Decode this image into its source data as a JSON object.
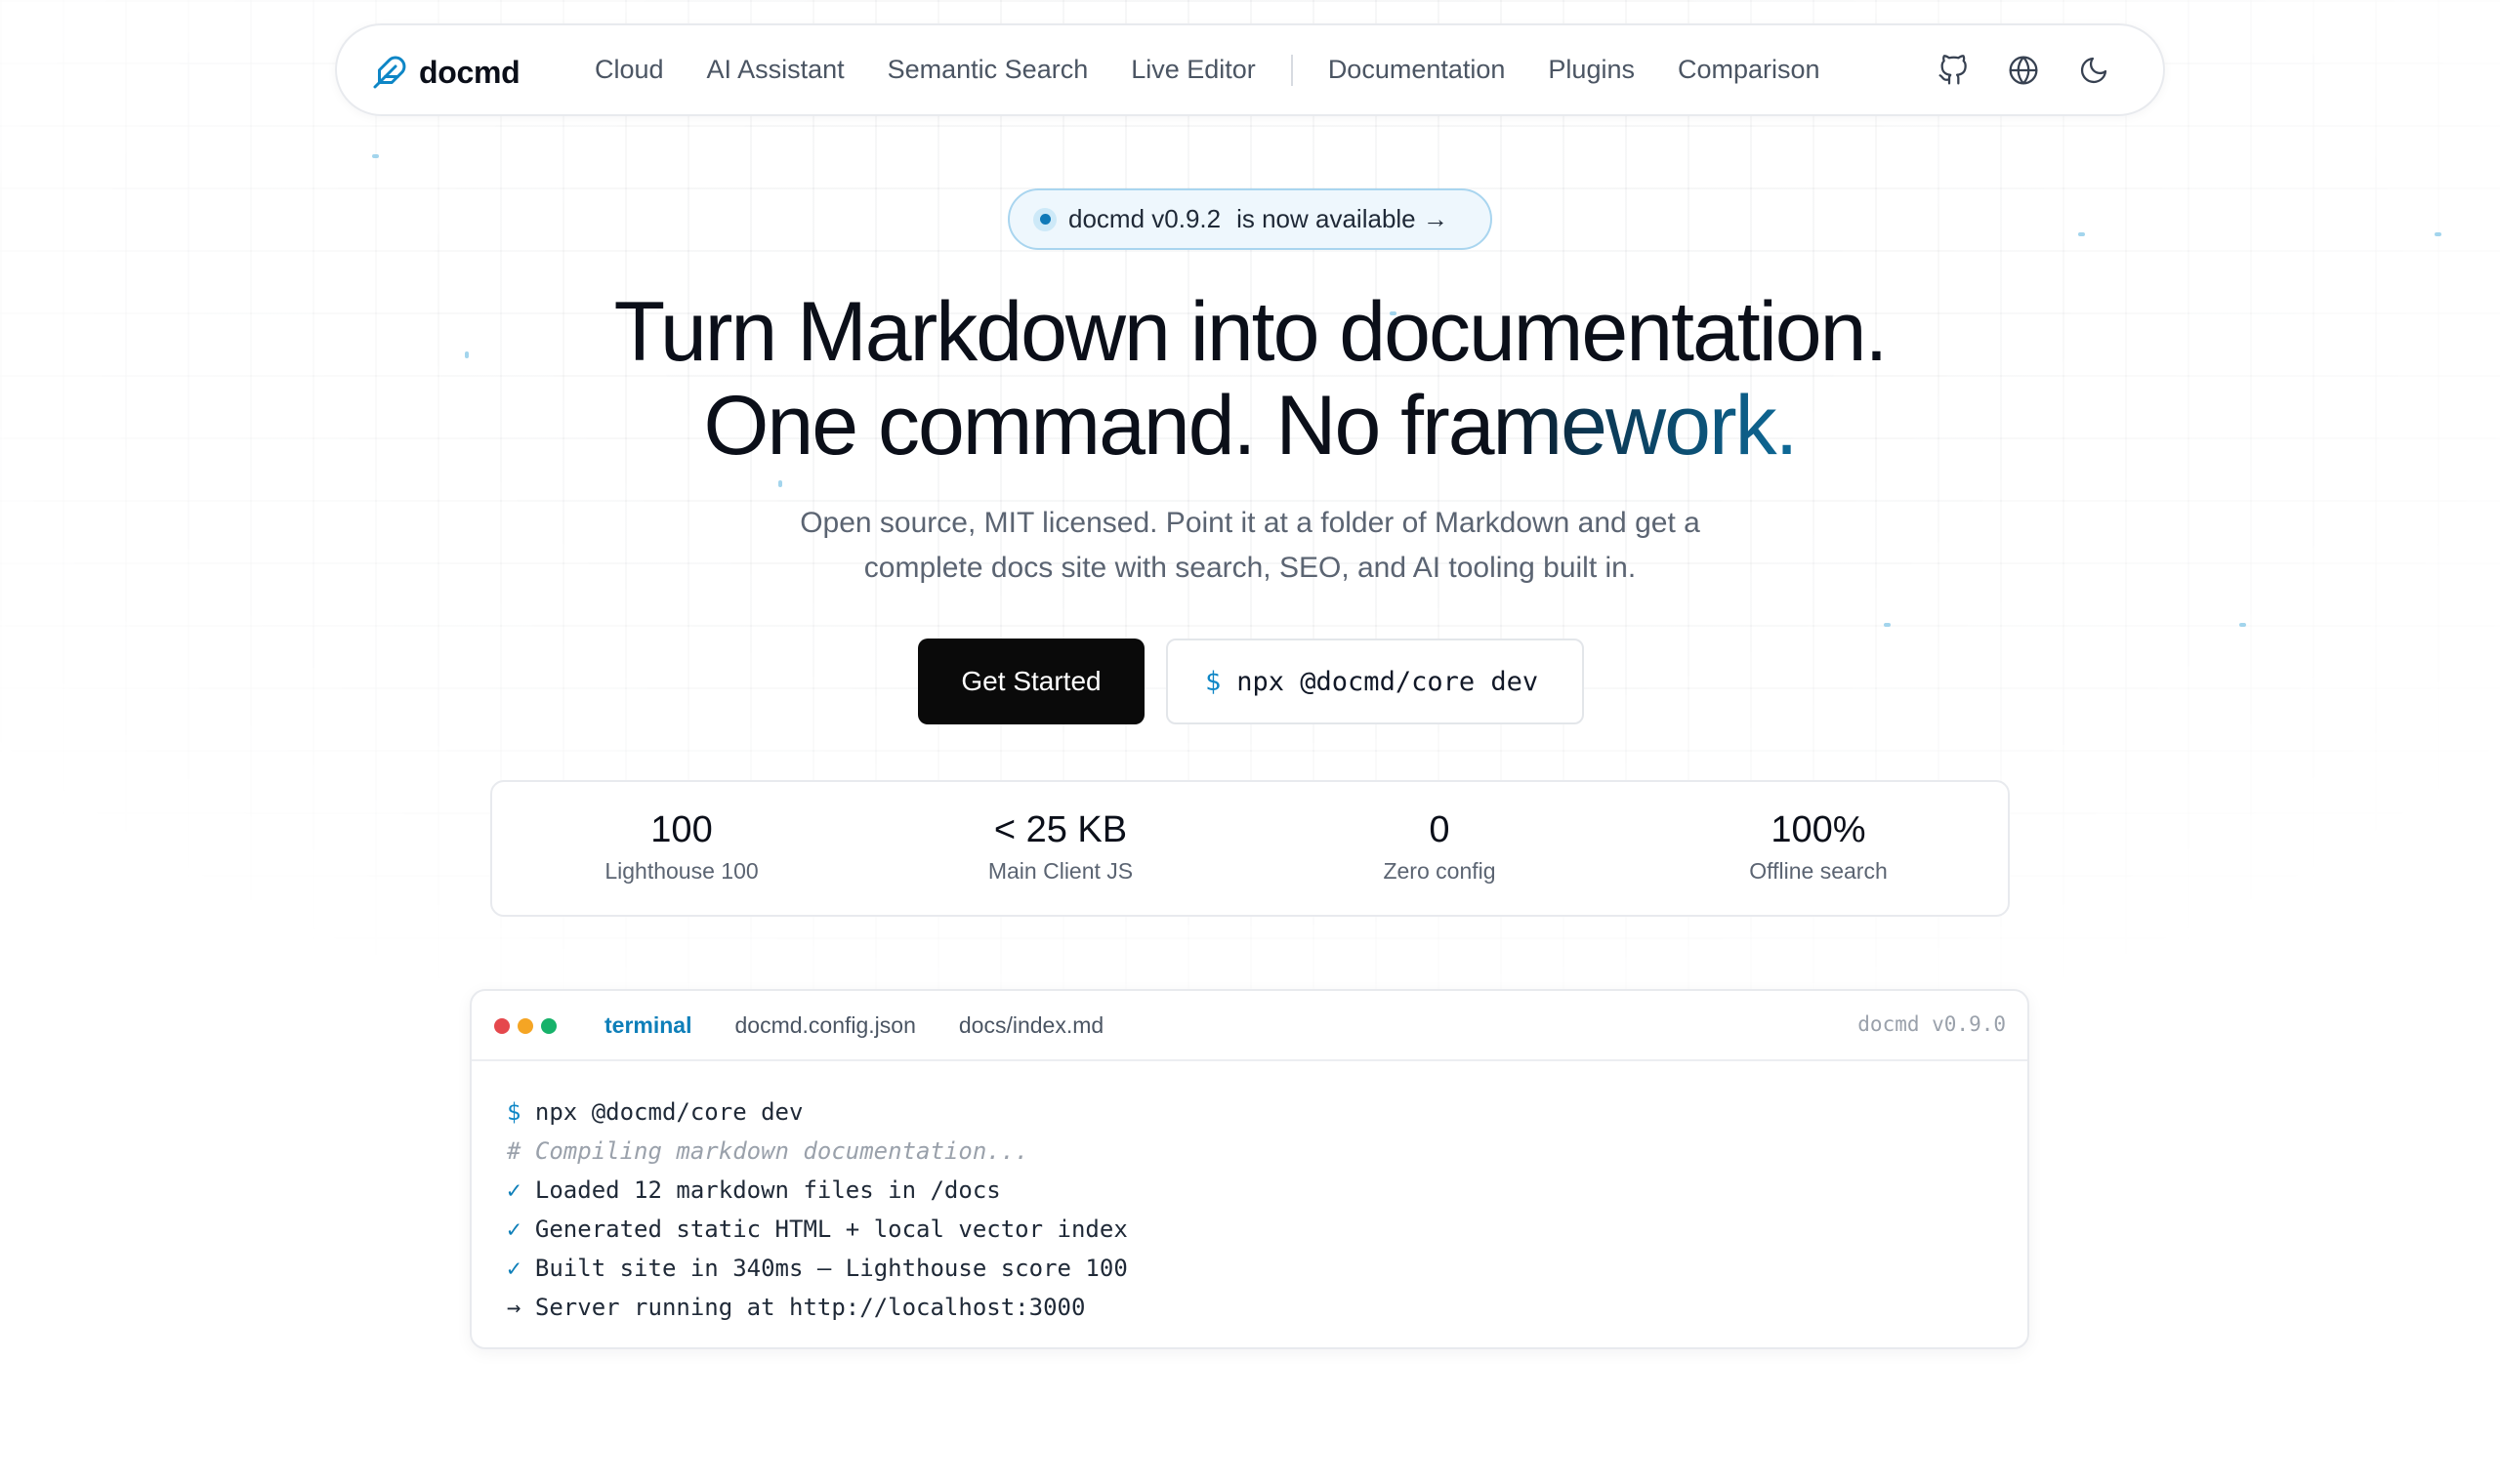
{
  "brand": {
    "name": "docmd",
    "icon": "feather-icon"
  },
  "nav": {
    "links": [
      {
        "id": "cloud",
        "label": "Cloud"
      },
      {
        "id": "ai-assistant",
        "label": "AI Assistant"
      },
      {
        "id": "semantic-search",
        "label": "Semantic Search"
      },
      {
        "id": "live-editor",
        "label": "Live Editor"
      }
    ],
    "links2": [
      {
        "id": "documentation",
        "label": "Documentation"
      },
      {
        "id": "plugins",
        "label": "Plugins"
      },
      {
        "id": "comparison",
        "label": "Comparison"
      }
    ],
    "icons": [
      "github-icon",
      "globe-icon",
      "moon-icon"
    ]
  },
  "announcement": {
    "version": "docmd v0.9.2",
    "text": "is now available →"
  },
  "hero": {
    "title_line1": "Turn Markdown into documentation.",
    "title_line2_plain": "One command. No fra",
    "title_line2_accent": "mework.",
    "subtitle_line1": "Open source, MIT licensed. Point it at a folder of Markdown and get a",
    "subtitle_line2": "complete docs site with search, SEO, and AI tooling built in."
  },
  "cta": {
    "primary_label": "Get Started",
    "command_prompt": "$",
    "command": "npx @docmd/core dev"
  },
  "stats": [
    {
      "value": "100",
      "label": "Lighthouse 100"
    },
    {
      "value": "< 25 KB",
      "label": "Main Client JS"
    },
    {
      "value": "0",
      "label": "Zero config"
    },
    {
      "value": "100%",
      "label": "Offline search"
    }
  ],
  "terminal": {
    "tabs": [
      "terminal",
      "docmd.config.json",
      "docs/index.md"
    ],
    "active_tab": "terminal",
    "version": "docmd v0.9.0",
    "lines": [
      {
        "prefix": "$",
        "text": "npx @docmd/core dev"
      },
      {
        "comment": "# Compiling markdown documentation..."
      },
      {
        "prefix": "✓",
        "text": "Loaded 12 markdown files in /docs"
      },
      {
        "prefix": "✓",
        "text": "Generated static HTML + local vector index"
      },
      {
        "prefix": "✓",
        "text": "Built site in 340ms — Lighthouse score 100"
      },
      {
        "prefix": "→",
        "text": "Server running at http://localhost:3000"
      }
    ]
  },
  "colors": {
    "accent": "#0e7fb9",
    "primary_button": "#0a0a0a",
    "pill_bg": "#eef7fd"
  }
}
